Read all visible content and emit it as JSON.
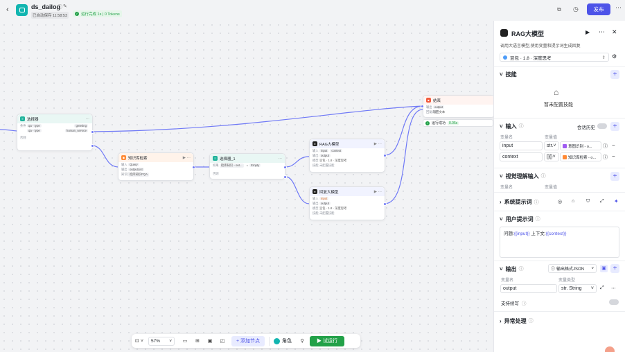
{
  "header": {
    "title": "ds_dailog",
    "saved": "已自动保存 11:58:53",
    "run_status": "运行完成 1s | 0 Tokens",
    "publish": "发布"
  },
  "nodes": {
    "selector": {
      "title": "选择器",
      "cond_label": "条件",
      "r1a": "qa - type",
      "r1b": "greeting",
      "r2a": "qa - type",
      "r2b": "human_service",
      "else": "否则"
    },
    "kb": {
      "title": "知识库检索",
      "in_label": "输入",
      "in_val": "Query",
      "out_label": "输出",
      "out_val": "outputList",
      "kb_label": "知识库",
      "kb_val": "检库知识FQA"
    },
    "selector1": {
      "title": "选择器_1",
      "cond_label": "如果",
      "a": "检库知识 - out...",
      "op": "=",
      "b": "Empty",
      "else": "否则"
    },
    "rag": {
      "title": "RAG大模型",
      "in_label": "输入",
      "in1": "input",
      "in2": "context",
      "out_label": "输出",
      "out_val": "output",
      "model_label": "模型",
      "model_val": "豆包 · 1.8 · 深度思考",
      "skill_label": "技能",
      "skill_val": "未配置技能"
    },
    "reject": {
      "title": "回复大模型",
      "in_label": "输入",
      "in1": "input",
      "out_label": "输出",
      "out_val": "output",
      "model_label": "模型",
      "model_val": "豆包 · 1.8 · 深度思考",
      "skill_label": "技能",
      "skill_val": "未配置技能"
    },
    "end": {
      "title": "结束",
      "out_label": "输出",
      "out_val": "output",
      "ret_label": "回复内容",
      "ret_val": "返回文本",
      "success": "运行成功",
      "time": "0.05s"
    }
  },
  "toolbar": {
    "zoom": "57%",
    "add_node": "添加节点",
    "role": "角色",
    "test_run": "试运行"
  },
  "panel": {
    "title": "RAG大模型",
    "subtitle": "调用大语言模型,使用变量和提示词生成回复",
    "model": "豆包 · 1.8 · 深度思考",
    "skills": {
      "title": "技能",
      "empty": "暂未配置技能"
    },
    "input": {
      "title": "输入",
      "history": "会话历史",
      "col_name": "变量名",
      "col_value": "变量值",
      "rows": [
        {
          "name": "input",
          "type": "str.",
          "value": "意图识别 - o..."
        },
        {
          "name": "context",
          "type": "[]{}",
          "value": "知识库检索 - o..."
        }
      ]
    },
    "vision": {
      "title": "视觉理解输入",
      "col_name": "变量名",
      "col_value": "变量值"
    },
    "system_prompt": {
      "title": "系统提示词"
    },
    "user_prompt": {
      "title": "用户提示词",
      "prefix": "问题:",
      "var1": "{{input}}",
      "mid": " 上下文:",
      "var2": "{{context}}"
    },
    "output": {
      "title": "输出",
      "format": "输出格式JSON",
      "col_name": "变量名",
      "col_type": "变量类型",
      "var": "output",
      "type": "str. String",
      "stream": "支持续写"
    },
    "error": {
      "title": "异常处理"
    }
  }
}
